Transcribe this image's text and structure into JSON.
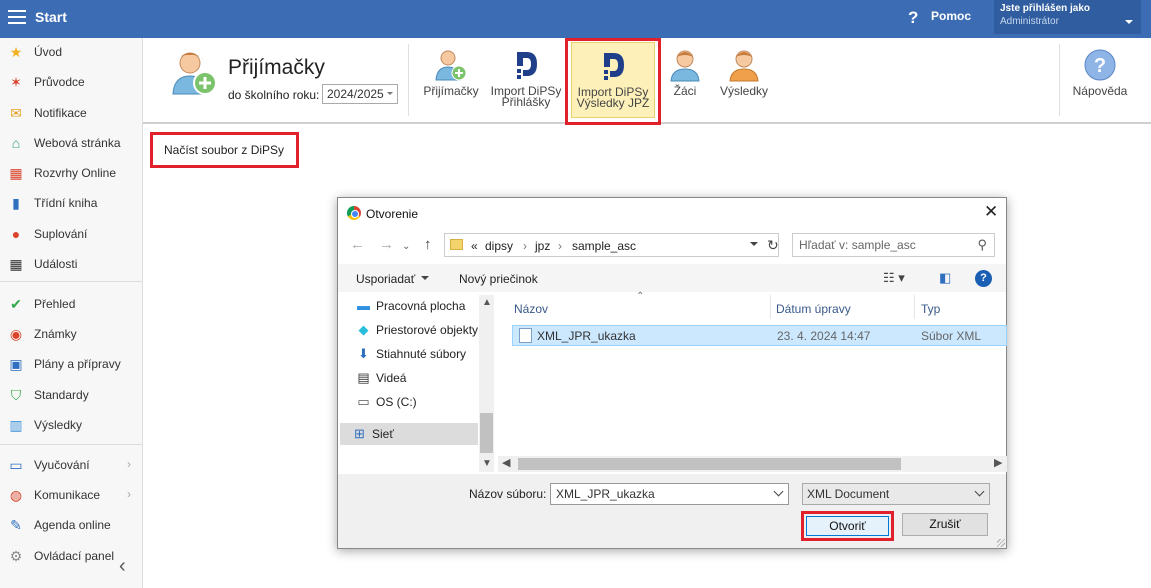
{
  "topbar": {
    "title": "Start",
    "help_label": "Pomoc",
    "help_glyph": "?",
    "user_line1": "Jste přihlášen jako",
    "user_line2": "Administrátor"
  },
  "sidebar": {
    "items": [
      {
        "label": "Úvod",
        "icon": "star-icon"
      },
      {
        "label": "Průvodce",
        "icon": "wand-icon"
      },
      {
        "label": "Notifikace",
        "icon": "envelope-icon"
      },
      {
        "label": "Webová stránka",
        "icon": "home-icon"
      },
      {
        "label": "Rozvrhy Online",
        "icon": "grid-icon"
      },
      {
        "label": "Třídní kniha",
        "icon": "book-icon"
      },
      {
        "label": "Suplování",
        "icon": "person-icon"
      },
      {
        "label": "Události",
        "icon": "calendar-icon"
      },
      {
        "label": "Přehled",
        "icon": "check-icon"
      },
      {
        "label": "Známky",
        "icon": "grade-icon"
      },
      {
        "label": "Plány a přípravy",
        "icon": "briefcase-icon"
      },
      {
        "label": "Standardy",
        "icon": "shield-icon"
      },
      {
        "label": "Výsledky",
        "icon": "barchart-icon"
      },
      {
        "label": "Vyučování",
        "icon": "screen-icon"
      },
      {
        "label": "Komunikace",
        "icon": "chat-icon"
      },
      {
        "label": "Agenda online",
        "icon": "pen-icon"
      },
      {
        "label": "Ovládací panel",
        "icon": "gear-icon"
      }
    ],
    "chevron": "›",
    "collapse_glyph": "‹"
  },
  "toolbar": {
    "title": "Přijímačky",
    "year_label": "do školního roku:",
    "year_value": "2024/2025",
    "buttons": {
      "prijimacky": "Přijímačky",
      "import_prihlasky_1": "Import DiPSy",
      "import_prihlasky_2": "Přihlášky",
      "import_vysledky_1": "Import DiPSy",
      "import_vysledky_2": "Výsledky JPZ",
      "zaci": "Žáci",
      "vysledky": "Výsledky",
      "napoveda": "Nápověda"
    }
  },
  "load_button": "Načíst soubor z DiPSy",
  "dialog": {
    "title": "Otvorenie",
    "close_glyph": "✕",
    "path": [
      "«",
      "dipsy",
      "›",
      "jpz",
      "›",
      "sample_asc"
    ],
    "search_placeholder": "Hľadať v: sample_asc",
    "organize": "Usporiadať",
    "new_folder": "Nový priečinok",
    "nav_items": [
      {
        "label": "Pracovná plocha",
        "icon": "desktop-icon"
      },
      {
        "label": "Priestorové objekty",
        "icon": "cube-icon"
      },
      {
        "label": "Stiahnuté súbory",
        "icon": "download-icon"
      },
      {
        "label": "Videá",
        "icon": "film-icon"
      },
      {
        "label": "OS (C:)",
        "icon": "drive-icon"
      },
      {
        "label": "Sieť",
        "icon": "network-icon"
      }
    ],
    "columns": {
      "name": "Názov",
      "date": "Dátum úpravy",
      "type": "Typ"
    },
    "files": [
      {
        "name": "XML_JPR_ukazka",
        "date": "23. 4. 2024 14:47",
        "type": "Súbor XML"
      }
    ],
    "filename_label": "Názov súboru:",
    "filename_value": "XML_JPR_ukazka",
    "filetype_value": "XML Document",
    "open_label": "Otvoriť",
    "cancel_label": "Zrušiť"
  },
  "colors": {
    "topbar": "#3c6db4",
    "highlight": "#e0202a",
    "active_button": "#fdf1b9",
    "selection": "#cce8ff"
  }
}
